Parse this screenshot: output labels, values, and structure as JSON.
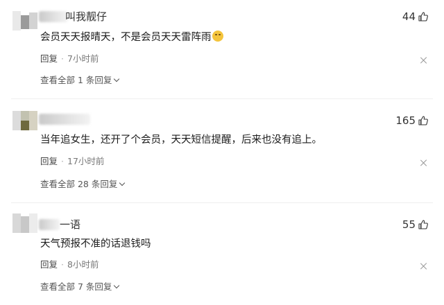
{
  "comments": [
    {
      "username": "叫我靓仔",
      "text": "会员天天报晴天，不是会员天天雷阵雨",
      "emoji_icon": "thinking-face-emoji",
      "reply_label": "回复",
      "time": "7小时前",
      "likes": "44",
      "view_all": "查看全部 1 条回复"
    },
    {
      "username": "",
      "text": "当年追女生，还开了个会员，天天短信提醒，后来也没有追上。",
      "reply_label": "回复",
      "time": "17小时前",
      "likes": "165",
      "view_all": "查看全部 28 条回复"
    },
    {
      "username": "一语",
      "text": "天气预报不准的话退钱吗",
      "reply_label": "回复",
      "time": "8小时前",
      "likes": "55",
      "view_all": "查看全部 7 条回复"
    }
  ]
}
